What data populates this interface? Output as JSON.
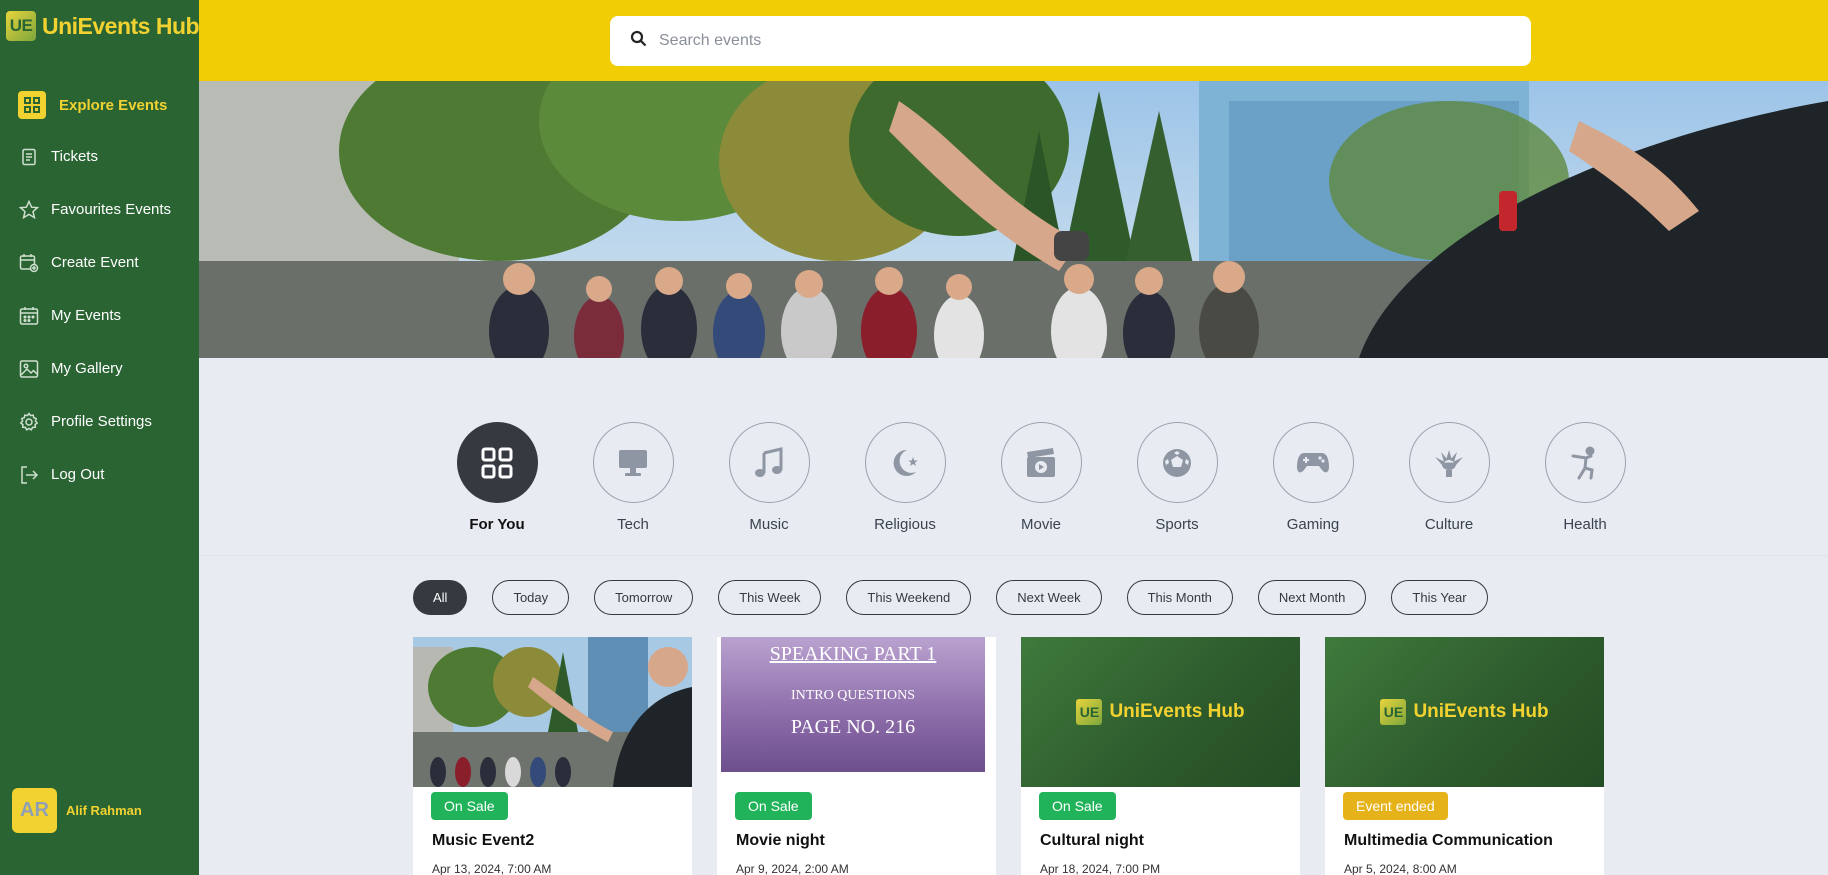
{
  "app": {
    "logo_mark": "UE",
    "logo_text": "UniEvents Hub"
  },
  "sidebar": {
    "items": [
      {
        "label": "Explore Events",
        "icon": "grid-icon",
        "active": true
      },
      {
        "label": "Tickets",
        "icon": "document-icon"
      },
      {
        "label": "Favourites Events",
        "icon": "star-icon"
      },
      {
        "label": "Create Event",
        "icon": "calendar-plus-icon"
      },
      {
        "label": "My Events",
        "icon": "calendar-icon"
      },
      {
        "label": "My Gallery",
        "icon": "image-icon"
      },
      {
        "label": "Profile Settings",
        "icon": "gear-icon"
      },
      {
        "label": "Log Out",
        "icon": "logout-icon"
      }
    ],
    "user": {
      "initials": "AR",
      "name": "Alif Rahman"
    }
  },
  "search": {
    "placeholder": "Search events"
  },
  "categories": [
    {
      "label": "For You",
      "icon": "grid-icon",
      "active": true
    },
    {
      "label": "Tech",
      "icon": "monitor-icon"
    },
    {
      "label": "Music",
      "icon": "music-note-icon"
    },
    {
      "label": "Religious",
      "icon": "crescent-star-icon"
    },
    {
      "label": "Movie",
      "icon": "film-clapper-icon"
    },
    {
      "label": "Sports",
      "icon": "soccer-ball-icon"
    },
    {
      "label": "Gaming",
      "icon": "gamepad-icon"
    },
    {
      "label": "Culture",
      "icon": "headdress-icon"
    },
    {
      "label": "Health",
      "icon": "yoga-pose-icon"
    }
  ],
  "filters": [
    "All",
    "Today",
    "Tomorrow",
    "This Week",
    "This Weekend",
    "Next Week",
    "This Month",
    "Next Month",
    "This Year"
  ],
  "events": [
    {
      "title": "Music Event2",
      "date": "Apr 13, 2024, 7:00 AM",
      "status": "On Sale"
    },
    {
      "title": "Movie night",
      "date": "Apr 9, 2024, 2:00 AM",
      "status": "On Sale",
      "image_text": {
        "line1": "SPEAKING PART 1",
        "line2": "INTRO QUESTIONS",
        "line3": "PAGE NO. 216"
      }
    },
    {
      "title": "Cultural night",
      "date": "Apr 18, 2024, 7:00 PM",
      "status": "On Sale",
      "image_brand": {
        "mark": "UE",
        "text": "UniEvents Hub"
      }
    },
    {
      "title": "Multimedia Communication",
      "date": "Apr 5, 2024, 8:00 AM",
      "status": "Event ended",
      "image_brand": {
        "mark": "UE",
        "text": "UniEvents Hub"
      }
    }
  ],
  "colors": {
    "sidebar_bg": "#2a6433",
    "accent_yellow": "#f0cd05",
    "on_sale": "#21b35a",
    "ended": "#e6b219",
    "dark": "#343a40"
  }
}
